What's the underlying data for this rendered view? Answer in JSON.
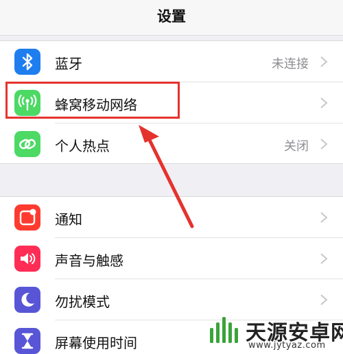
{
  "header": {
    "title": "设置"
  },
  "group_connectivity": [
    {
      "label": "蓝牙",
      "value": "未连接",
      "icon": "bluetooth-icon",
      "color": "#1e7ef0"
    },
    {
      "label": "蜂窝移动网络",
      "value": "",
      "icon": "cellular-antenna-icon",
      "color": "#4cd964"
    },
    {
      "label": "个人热点",
      "value": "关闭",
      "icon": "hotspot-chain-icon",
      "color": "#4cd964"
    }
  ],
  "group_notifications": [
    {
      "label": "通知",
      "value": "",
      "icon": "notifications-icon",
      "color": "#ff3b30"
    },
    {
      "label": "声音与触感",
      "value": "",
      "icon": "speaker-icon",
      "color": "#ff2d55"
    },
    {
      "label": "勿扰模式",
      "value": "",
      "icon": "moon-icon",
      "color": "#5856d6"
    },
    {
      "label": "屏幕使用时间",
      "value": "",
      "icon": "hourglass-icon",
      "color": "#5856d6"
    }
  ],
  "annotation": {
    "highlight_color": "#e5322d"
  },
  "watermark": {
    "name": "天源安卓网",
    "url": "www.jytyaz.com",
    "logo_color": "#3aa33a"
  }
}
